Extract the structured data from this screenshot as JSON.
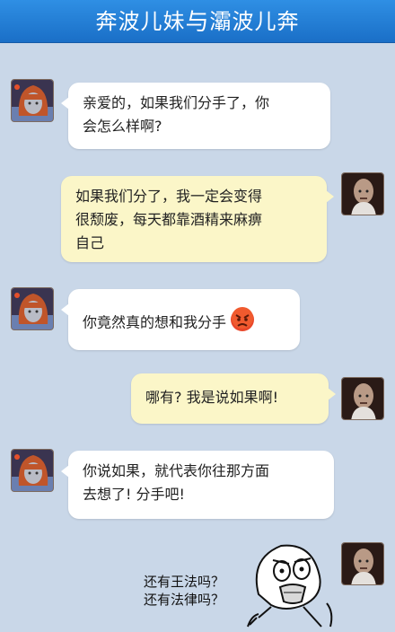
{
  "header": {
    "title_left": "奔波儿妹",
    "title_sep": "与",
    "title_right": "灞波儿奔"
  },
  "messages": [
    {
      "side": "left",
      "avatar": "girl-avatar",
      "lines": [
        "亲爱的，如果我们分手了，你",
        "会怎么样啊?"
      ]
    },
    {
      "side": "right",
      "avatar": "bald-man-avatar",
      "lines": [
        "如果我们分了，我一定会变得",
        "很颓废，每天都靠酒精来麻痹",
        "自己"
      ]
    },
    {
      "side": "left",
      "avatar": "girl-avatar",
      "lines": [
        "你竟然真的想和我分手"
      ],
      "emoji": "angry-face-icon"
    },
    {
      "side": "right",
      "avatar": "bald-man-avatar",
      "lines": [
        "哪有? 我是说如果啊!"
      ]
    },
    {
      "side": "left",
      "avatar": "girl-avatar",
      "lines": [
        "你说如果，就代表你往那方面",
        "去想了! 分手吧!"
      ]
    }
  ],
  "meme": {
    "avatar": "bald-man-avatar",
    "face": "y-u-no-rage-face",
    "caption_lines": [
      "还有王法吗？",
      "还有法律吗？"
    ]
  },
  "colors": {
    "background": "#c9d7e8",
    "header": "#1a6fc7",
    "bubble_left": "#ffffff",
    "bubble_right": "#fbf6c8"
  }
}
